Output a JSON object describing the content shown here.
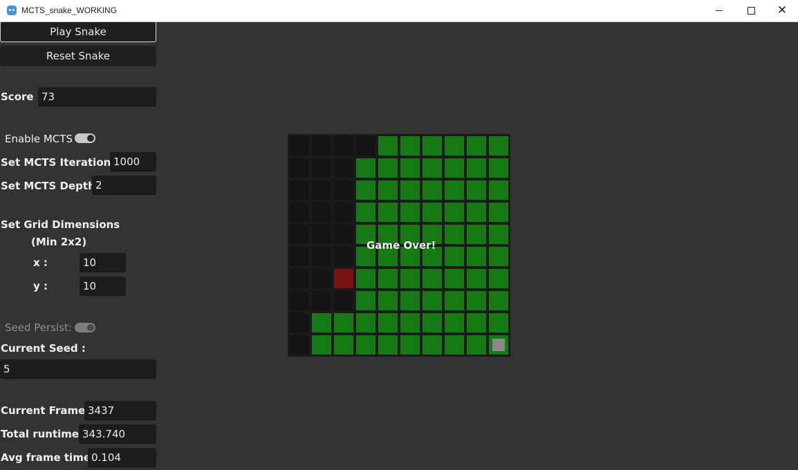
{
  "window": {
    "title": "MCTS_snake_WORKING",
    "minimize": "–",
    "maximize": "□",
    "close": "✕"
  },
  "controls": {
    "play_label": "Play Snake",
    "reset_label": "Reset  Snake",
    "score_label": "Score :",
    "score_value": "73",
    "enable_mcts_label": "Enable MCTS",
    "enable_mcts_on": true,
    "iterations_label": "Set MCTS Iterations :",
    "iterations_value": "1000",
    "depth_label": "Set MCTS Depth :",
    "depth_value": "2",
    "grid_dims_label": "Set Grid Dimensions",
    "grid_min_label": "(Min 2x2)",
    "x_label": "x :",
    "x_value": "10",
    "y_label": "y :",
    "y_value": "10",
    "seed_persist_label": "Seed Persist:",
    "seed_persist_on": true,
    "current_seed_label": "Current Seed :",
    "current_seed_value": "5",
    "current_frame_label": "Current Frame :",
    "current_frame_value": "3437",
    "total_runtime_label": "Total runtime :",
    "total_runtime_value": "343.740",
    "avg_frame_label": "Avg frame time :",
    "avg_frame_value": "0.104"
  },
  "game": {
    "status_text": "Game Over!",
    "cols": 10,
    "rows": 10,
    "board": [
      "....SSSSSS",
      "...SSSSSSS",
      "...SSSSSSS",
      "...SSSSSSS",
      "...SSSSSSS",
      "...SSSSSSS",
      "..FSSSSSSS",
      "...SSSSSSS",
      ".SSSSSSSSS",
      ".SSSSSSSSH"
    ],
    "colors": {
      "empty": "#141414",
      "snake": "#157a15",
      "food": "#7a1414",
      "head": "#8a8a8a"
    }
  }
}
